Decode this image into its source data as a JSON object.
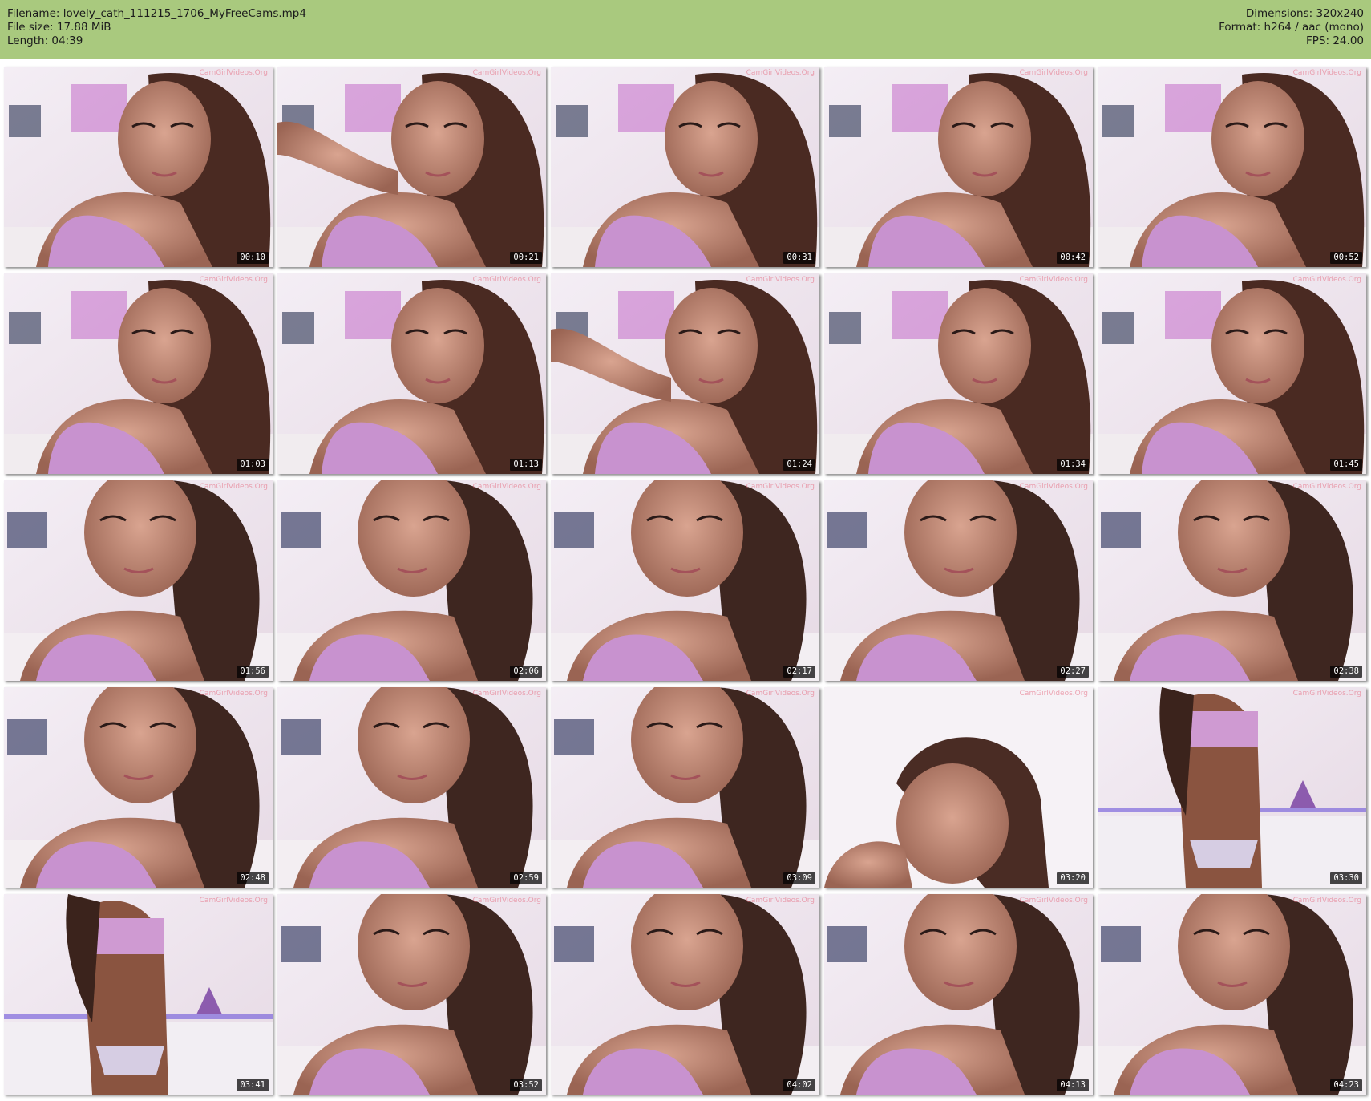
{
  "header": {
    "filename_line": "Filename: lovely_cath_111215_1706_MyFreeCams.mp4",
    "filesize_line": "File size: 17.88 MiB",
    "length_line": "Length: 04:39",
    "dimensions_line": "Dimensions: 320x240",
    "format_line": "Format: h264 / aac (mono)",
    "fps_line": "FPS: 24.00"
  },
  "watermark": "CamGirlVideos.Org",
  "colors": {
    "header_bg": "#a9c97e",
    "timestamp_bg": "#000000",
    "timestamp_text": "#ffffff"
  },
  "thumbnails": [
    {
      "timestamp": "00:10"
    },
    {
      "timestamp": "00:21"
    },
    {
      "timestamp": "00:31"
    },
    {
      "timestamp": "00:42"
    },
    {
      "timestamp": "00:52"
    },
    {
      "timestamp": "01:03"
    },
    {
      "timestamp": "01:13"
    },
    {
      "timestamp": "01:24"
    },
    {
      "timestamp": "01:34"
    },
    {
      "timestamp": "01:45"
    },
    {
      "timestamp": "01:56"
    },
    {
      "timestamp": "02:06"
    },
    {
      "timestamp": "02:17"
    },
    {
      "timestamp": "02:27"
    },
    {
      "timestamp": "02:38"
    },
    {
      "timestamp": "02:48"
    },
    {
      "timestamp": "02:59"
    },
    {
      "timestamp": "03:09"
    },
    {
      "timestamp": "03:20"
    },
    {
      "timestamp": "03:30"
    },
    {
      "timestamp": "03:41"
    },
    {
      "timestamp": "03:52"
    },
    {
      "timestamp": "04:02"
    },
    {
      "timestamp": "04:13"
    },
    {
      "timestamp": "04:23"
    }
  ]
}
